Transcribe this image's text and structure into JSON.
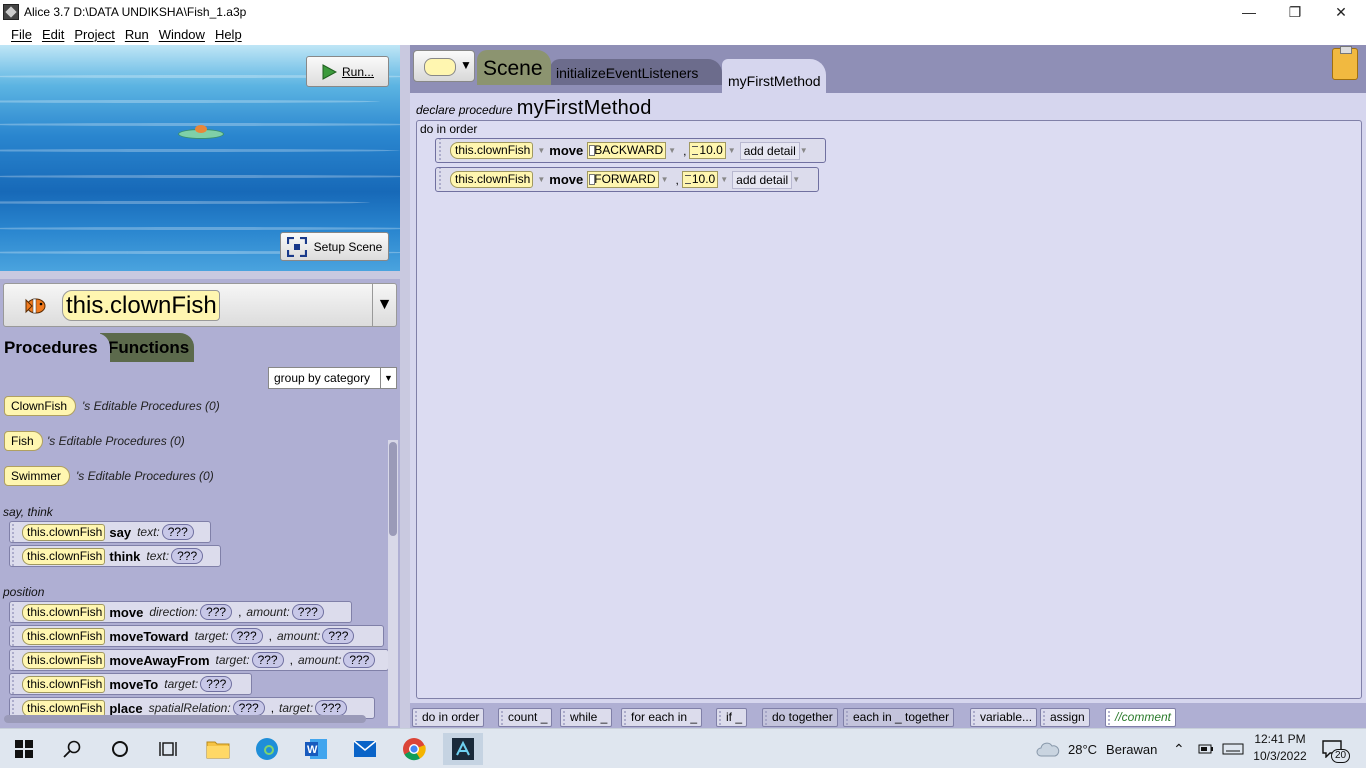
{
  "window": {
    "title": "Alice 3.7 D:\\DATA UNDIKSHA\\Fish_1.a3p",
    "minimize": "—",
    "maximize": "❐",
    "close": "✕"
  },
  "menu": [
    "File",
    "Edit",
    "Project",
    "Run",
    "Window",
    "Help"
  ],
  "scene": {
    "run_label": "Run...",
    "setup_label": "Setup Scene"
  },
  "selected_object": "this.clownFish",
  "left_tabs": {
    "procedures": "Procedures",
    "functions": "Functions"
  },
  "group_select": "group by category",
  "editable": [
    {
      "type": "ClownFish",
      "label": "'s Editable Procedures (0)"
    },
    {
      "type": "Fish",
      "label": "'s Editable Procedures (0)"
    },
    {
      "type": "Swimmer",
      "label": "'s Editable Procedures (0)"
    }
  ],
  "categories": {
    "say_think": "say, think",
    "position": "position"
  },
  "tiles": {
    "say": {
      "obj": "this.clownFish",
      "method": "say",
      "p1": "text:",
      "v1": "???"
    },
    "think": {
      "obj": "this.clownFish",
      "method": "think",
      "p1": "text:",
      "v1": "???"
    },
    "move": {
      "obj": "this.clownFish",
      "method": "move",
      "p1": "direction:",
      "v1": "???",
      "p2": "amount:",
      "v2": "???"
    },
    "moveToward": {
      "obj": "this.clownFish",
      "method": "moveToward",
      "p1": "target:",
      "v1": "???",
      "p2": "amount:",
      "v2": "???"
    },
    "moveAwayFrom": {
      "obj": "this.clownFish",
      "method": "moveAwayFrom",
      "p1": "target:",
      "v1": "???",
      "p2": "amount:",
      "v2": "???"
    },
    "moveTo": {
      "obj": "this.clownFish",
      "method": "moveTo",
      "p1": "target:",
      "v1": "???"
    },
    "place": {
      "obj": "this.clownFish",
      "method": "place",
      "p1": "spatialRelation:",
      "v1": "???",
      "p2": "target:",
      "v2": "???"
    }
  },
  "code_tabs": {
    "scene": "Scene",
    "init": "initializeEventListeners",
    "method": "myFirstMethod"
  },
  "editor": {
    "declare_label": "declare procedure",
    "method_name": "myFirstMethod",
    "do_in_order": "do in order",
    "statements": [
      {
        "obj": "this.clownFish",
        "method": "move",
        "direction": "BACKWARD",
        "amount": "10.0",
        "detail": "add detail"
      },
      {
        "obj": "this.clownFish",
        "method": "move",
        "direction": "FORWARD",
        "amount": "10.0",
        "detail": "add detail"
      }
    ]
  },
  "controls": [
    "do in order",
    "count _",
    "while _",
    "for each in _",
    "if _",
    "do together",
    "each in _ together",
    "variable...",
    "assign",
    "//comment"
  ],
  "taskbar": {
    "weather_temp": "28°C",
    "weather_desc": "Berawan",
    "time": "12:41 PM",
    "date": "10/3/2022",
    "notif_count": "20"
  },
  "colors": {
    "accent_yellow": "#fff6b0",
    "procedures_tab": "#afafd3",
    "functions_tab": "#5c6a4c",
    "scene_tab": "#8c9470"
  }
}
